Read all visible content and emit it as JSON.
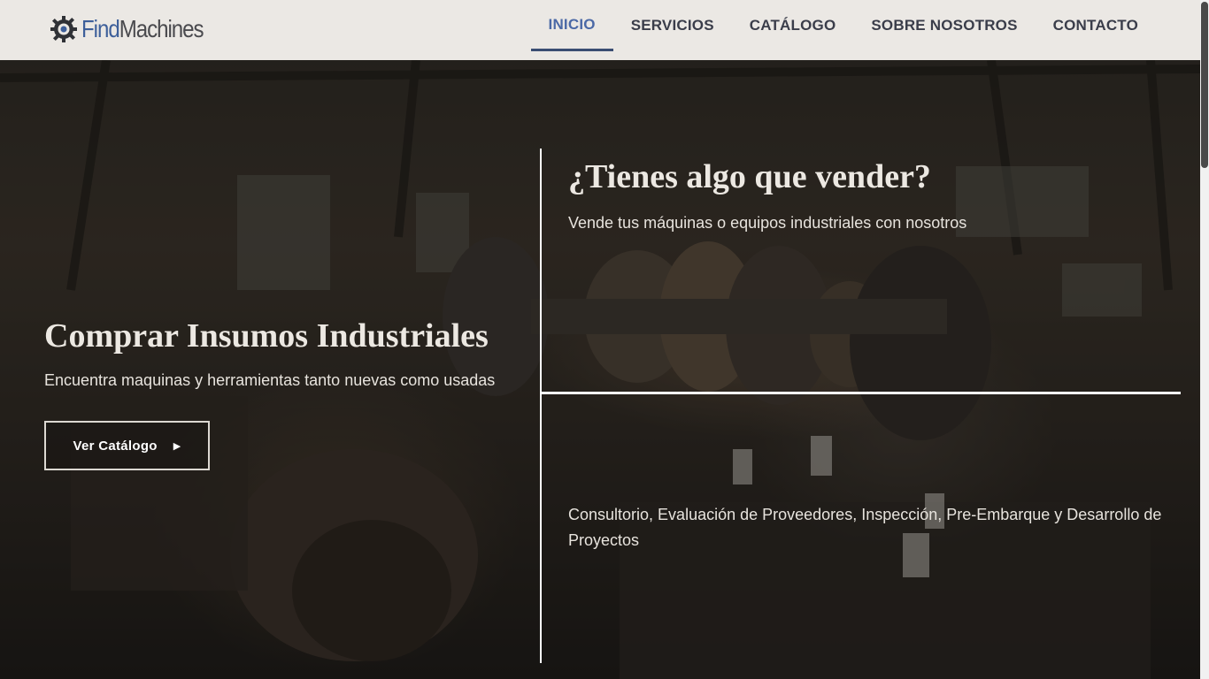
{
  "brand": {
    "name_part1": "Find",
    "name_part2": "Machines",
    "icon": "gear-logo-icon"
  },
  "nav": [
    {
      "label": "INICIO",
      "active": true
    },
    {
      "label": "SERVICIOS",
      "active": false
    },
    {
      "label": "CATÁLOGO",
      "active": false
    },
    {
      "label": "SOBRE NOSOTROS",
      "active": false
    },
    {
      "label": "CONTACTO",
      "active": false
    }
  ],
  "hero": {
    "left": {
      "title": "Comprar Insumos Industriales",
      "subtitle": "Encuentra maquinas y herramientas tanto nuevas como usadas",
      "button_label": "Ver Catálogo"
    },
    "right_top": {
      "title": "¿Tienes algo que vender?",
      "subtitle": "Vende tus máquinas o equipos industriales con nosotros"
    },
    "right_bottom": {
      "services": "Consultorio, Evaluación de Proveedores, Inspección, Pre-Embarque y Desarrollo de Proyectos"
    }
  },
  "colors": {
    "header_bg": "#ebe8e4",
    "nav_active": "#4b69a6",
    "nav_text": "#3a3d4a",
    "brand_blue": "#3d5f9a",
    "brand_gray": "#4a4a4e"
  }
}
